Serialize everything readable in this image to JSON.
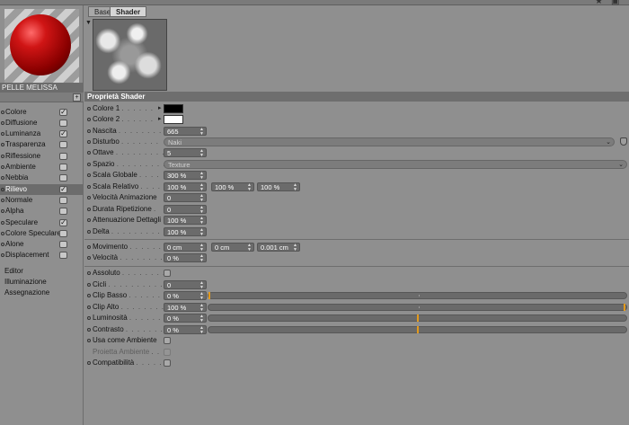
{
  "material": {
    "name": "PELLE MELISSA",
    "channels": [
      {
        "label": "Colore",
        "checked": true
      },
      {
        "label": "Diffusione",
        "checked": false
      },
      {
        "label": "Luminanza",
        "checked": true
      },
      {
        "label": "Trasparenza",
        "checked": false
      },
      {
        "label": "Riflessione",
        "checked": false
      },
      {
        "label": "Ambiente",
        "checked": false
      },
      {
        "label": "Nebbia",
        "checked": false
      },
      {
        "label": "Rilievo",
        "checked": true,
        "selected": true
      },
      {
        "label": "Normale",
        "checked": false
      },
      {
        "label": "Alpha",
        "checked": false
      },
      {
        "label": "Speculare",
        "checked": true
      },
      {
        "label": "Colore Speculare",
        "checked": false
      },
      {
        "label": "Alone",
        "checked": false
      },
      {
        "label": "Displacement",
        "checked": false
      }
    ],
    "extra_items": [
      "Editor",
      "Illuminazione",
      "Assegnazione"
    ]
  },
  "tabs": [
    {
      "label": "Base",
      "active": false
    },
    {
      "label": "Shader",
      "active": true
    }
  ],
  "section_title": "Proprietà Shader",
  "colors": {
    "colore1": "#000000",
    "colore2": "#ffffff",
    "clip_marker": "#e39a1d"
  },
  "fields": {
    "colore1": "Colore 1",
    "colore2": "Colore 2",
    "nascita": {
      "label": "Nascita",
      "value": "665"
    },
    "disturbo": {
      "label": "Disturbo",
      "value": "Naki"
    },
    "ottave": {
      "label": "Ottave",
      "value": "5"
    },
    "spazio": {
      "label": "Spazio",
      "value": "Texture"
    },
    "scala_globale": {
      "label": "Scala Globale",
      "value": "300 %"
    },
    "scala_relativo": {
      "label": "Scala Relativo",
      "values": [
        "100 %",
        "100 %",
        "100 %"
      ]
    },
    "velocita_animazione": {
      "label": "Velocità Animazione",
      "value": "0"
    },
    "durata_ripetizione": {
      "label": "Durata Ripetizione",
      "value": "0"
    },
    "attenuazione_dettagli": {
      "label": "Attenuazione Dettagli",
      "value": "100 %"
    },
    "delta": {
      "label": "Delta",
      "value": "100 %"
    },
    "movimento": {
      "label": "Movimento",
      "values": [
        "0 cm",
        "0 cm",
        "0.001 cm"
      ]
    },
    "velocita": {
      "label": "Velocità",
      "value": "0 %"
    },
    "assoluto": {
      "label": "Assoluto",
      "checked": false
    },
    "cicli": {
      "label": "Cicli",
      "value": "0"
    },
    "clip_basso": {
      "label": "Clip Basso",
      "value": "0 %",
      "fraction": 0.0
    },
    "clip_alto": {
      "label": "Clip Alto",
      "value": "100 %",
      "fraction": 1.0
    },
    "luminosita": {
      "label": "Luminosità",
      "value": "0 %",
      "fraction": 0.5
    },
    "contrasto": {
      "label": "Contrasto",
      "value": "0 %",
      "fraction": 0.5
    },
    "usa_come_ambiente": {
      "label": "Usa come Ambiente",
      "checked": false
    },
    "proietta_ambiente": {
      "label": "Proietta Ambiente",
      "checked": false,
      "disabled": true
    },
    "compatibilita": {
      "label": "Compatibilità",
      "checked": false
    }
  },
  "icons": {
    "material_toggle": "plus-icon",
    "preview_toggle": "triangle-down-icon"
  }
}
